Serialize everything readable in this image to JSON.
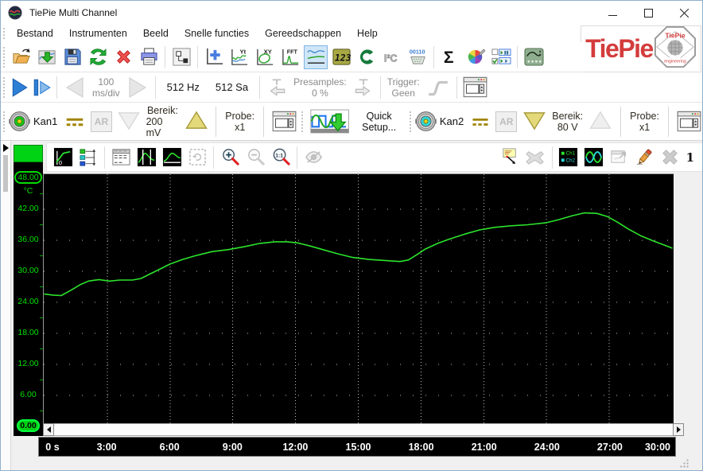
{
  "window": {
    "title": "TiePie Multi Channel"
  },
  "menu": {
    "items": [
      "Bestand",
      "Instrumenten",
      "Beeld",
      "Snelle functies",
      "Gereedschappen",
      "Help"
    ]
  },
  "logo": {
    "brand": "TiePie",
    "badge_title": "TiePie",
    "badge_subtitle": "engineering"
  },
  "icon_glyphs": {
    "yt": "Yt",
    "xy": "XY",
    "fft": "FFT",
    "meter": "123",
    "i2c": "I²C",
    "serial": "00110",
    "sigma": "Σ",
    "ch1": "Ch1",
    "ch2": "Ch2",
    "zoom_ratio": "1:1",
    "axis_zero": "0"
  },
  "toolbar_main": {
    "items": [
      {
        "icon": "open-file"
      },
      {
        "icon": "import-data"
      },
      {
        "icon": "save"
      },
      {
        "icon": "refresh"
      },
      {
        "icon": "delete"
      },
      {
        "icon": "print"
      },
      {
        "sep": true
      },
      {
        "icon": "object-tree"
      },
      {
        "sep": true
      },
      {
        "icon": "add-graph"
      },
      {
        "icon": "yt-graph"
      },
      {
        "icon": "xy-graph"
      },
      {
        "icon": "fft-graph"
      },
      {
        "icon": "active-graph",
        "active": true
      },
      {
        "icon": "meter-123"
      },
      {
        "icon": "gauge"
      },
      {
        "icon": "i2c-monitor"
      },
      {
        "icon": "serial-monitor"
      },
      {
        "sep": true
      },
      {
        "icon": "sigma-functions"
      },
      {
        "icon": "color-settings"
      },
      {
        "icon": "source-list"
      },
      {
        "sep": true
      },
      {
        "icon": "measure-instrument"
      }
    ]
  },
  "acquisition": {
    "timebase_value": "100",
    "timebase_unit": "ms/div",
    "sample_rate": "512 Hz",
    "record_length": "512 Sa",
    "presamples_label": "Presamples:",
    "presamples_value": "0 %",
    "trigger_label": "Trigger:",
    "trigger_value": "Geen"
  },
  "channels": [
    {
      "label": "Kan1",
      "color": "#17c317",
      "ar_label": "AR",
      "range_label": "Bereik:",
      "range_value": "200 mV",
      "probe_label": "Probe:",
      "probe_value": "x1",
      "down_enabled": false,
      "up_enabled": true
    },
    {
      "label": "Kan2",
      "color": "#2fd6d6",
      "ar_label": "AR",
      "range_label": "Bereik:",
      "range_value": "80 V",
      "probe_label": "Probe:",
      "probe_value": "x1",
      "down_enabled": true,
      "up_enabled": false
    }
  ],
  "quick_setup": {
    "label": "Quick Setup..."
  },
  "graph_toolbar": {
    "counter": "1",
    "items": [
      {
        "icon": "axis-zero"
      },
      {
        "icon": "channel-offsets"
      },
      {
        "sep": true
      },
      {
        "icon": "value-table"
      },
      {
        "icon": "vertical-cursors"
      },
      {
        "icon": "horizontal-cursors"
      },
      {
        "icon": "selection-zoom",
        "disabled": true
      },
      {
        "sep": true
      },
      {
        "icon": "zoom-in"
      },
      {
        "icon": "zoom-out",
        "disabled": true
      },
      {
        "icon": "zoom-one-one"
      },
      {
        "sep": true
      },
      {
        "icon": "hide-trace",
        "disabled": true
      },
      {
        "spacer": true
      },
      {
        "icon": "add-comment"
      },
      {
        "icon": "remove-comment",
        "disabled": true
      },
      {
        "sep": true
      },
      {
        "icon": "legend"
      },
      {
        "icon": "trace-colors"
      },
      {
        "icon": "export-graph",
        "disabled": true
      },
      {
        "icon": "eraser"
      },
      {
        "icon": "close-graph",
        "disabled": true
      },
      {
        "text": "1",
        "name": "graph-number"
      }
    ]
  },
  "chart_data": {
    "type": "line",
    "title": "",
    "y_unit": "°C",
    "ylim": [
      0,
      48
    ],
    "xlim_minutes": [
      0,
      30
    ],
    "grid": "dotted",
    "grid_color": "#bcbcbc",
    "y_tick_values": [
      48,
      42,
      36,
      30,
      24,
      18,
      12,
      6,
      0
    ],
    "y_tick_labels": [
      "48.00",
      "42.00",
      "36.00",
      "30.00",
      "24.00",
      "18.00",
      "12.00",
      "6.00",
      "0.00"
    ],
    "x_tick_minutes": [
      0,
      3,
      6,
      9,
      12,
      15,
      18,
      21,
      24,
      27,
      30
    ],
    "x_tick_labels": [
      "0 s",
      "3:00",
      "6:00",
      "9:00",
      "12:00",
      "15:00",
      "18:00",
      "21:00",
      "24:00",
      "27:00",
      "30:00"
    ],
    "series": [
      {
        "name": "Kan1",
        "color": "#2ce32c",
        "points": [
          [
            0,
            25.6
          ],
          [
            0.4,
            25.4
          ],
          [
            0.8,
            25.3
          ],
          [
            1.2,
            26.2
          ],
          [
            1.7,
            27.4
          ],
          [
            2.1,
            28.1
          ],
          [
            2.6,
            28.4
          ],
          [
            3.1,
            28.1
          ],
          [
            3.6,
            28.3
          ],
          [
            4.2,
            28.3
          ],
          [
            4.6,
            28.6
          ],
          [
            5.1,
            29.6
          ],
          [
            5.6,
            30.6
          ],
          [
            6,
            31.4
          ],
          [
            6.6,
            32.3
          ],
          [
            7.2,
            33.0
          ],
          [
            8,
            33.8
          ],
          [
            8.8,
            34.2
          ],
          [
            9.6,
            34.8
          ],
          [
            10.3,
            35.4
          ],
          [
            11,
            35.7
          ],
          [
            11.6,
            35.7
          ],
          [
            12.1,
            35.5
          ],
          [
            12.7,
            34.9
          ],
          [
            13.3,
            34.2
          ],
          [
            14,
            33.4
          ],
          [
            14.7,
            32.7
          ],
          [
            15.5,
            32.3
          ],
          [
            16.2,
            32.1
          ],
          [
            17,
            31.9
          ],
          [
            17.4,
            32.2
          ],
          [
            17.8,
            33.2
          ],
          [
            18.2,
            34.3
          ],
          [
            18.8,
            35.4
          ],
          [
            19.4,
            36.3
          ],
          [
            20.1,
            37.2
          ],
          [
            20.8,
            38.0
          ],
          [
            21.5,
            38.5
          ],
          [
            22.3,
            38.8
          ],
          [
            23.1,
            39.0
          ],
          [
            24,
            39.4
          ],
          [
            24.6,
            40.0
          ],
          [
            25.2,
            40.7
          ],
          [
            25.8,
            41.3
          ],
          [
            26.4,
            41.2
          ],
          [
            26.9,
            40.6
          ],
          [
            27.4,
            39.5
          ],
          [
            27.9,
            38.2
          ],
          [
            28.5,
            36.9
          ],
          [
            29.1,
            35.9
          ],
          [
            29.6,
            35.1
          ],
          [
            30,
            34.5
          ]
        ]
      }
    ]
  }
}
